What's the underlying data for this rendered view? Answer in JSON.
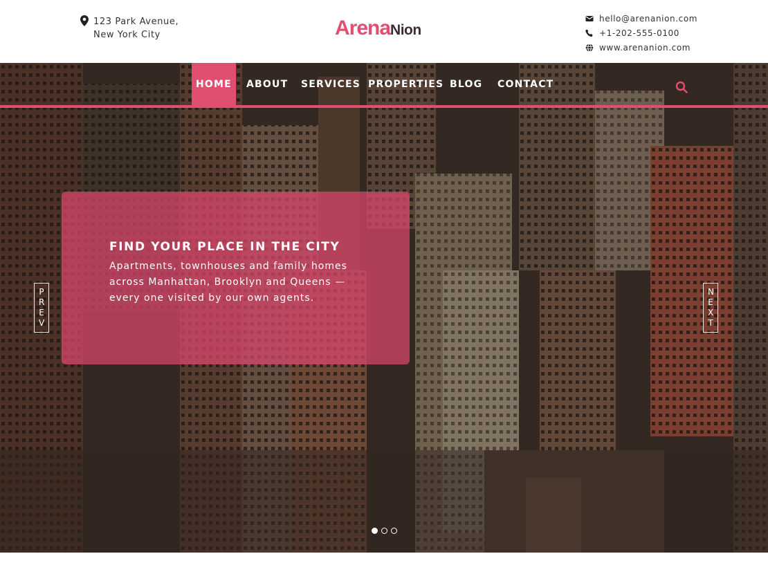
{
  "header": {
    "address_line1": "123 Park Avenue,",
    "address_line2": "New York City",
    "logo_part1": "Arena",
    "logo_part2": "Nion",
    "email": "hello@arenanion.com",
    "phone": "+1-202-555-0100",
    "website": "www.arenanion.com"
  },
  "nav": {
    "items": [
      "HOME",
      "ABOUT",
      "SERVICES",
      "PROPERTIES",
      "BLOG",
      "CONTACT"
    ],
    "active": "HOME"
  },
  "hero": {
    "title": "FIND YOUR PLACE IN THE CITY",
    "text": "Apartments, townhouses and family homes across Manhattan, Brooklyn and Queens — every one visited by our own agents.",
    "prev_label": "PREV",
    "next_label": "NEXT",
    "slides_total": 3,
    "slide_active": 1
  },
  "colors": {
    "accent": "#e04f6f",
    "logo_dark": "#3b2e33"
  },
  "icons": {
    "address": "map-pin-icon",
    "email": "envelope-icon",
    "phone": "phone-icon",
    "website": "globe-icon",
    "search": "search-icon"
  }
}
